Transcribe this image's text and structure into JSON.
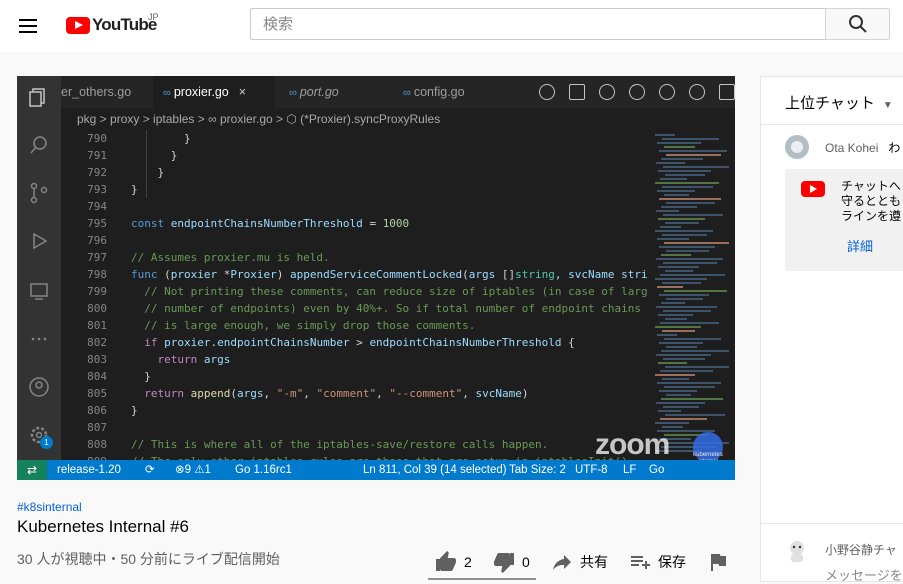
{
  "header": {
    "logo_text": "YouTube",
    "logo_region": "JP",
    "search_placeholder": "検索"
  },
  "player": {
    "tabs": [
      {
        "label": "er_others.go"
      },
      {
        "label": "proxier.go",
        "close": "×"
      },
      {
        "label": "port.go"
      },
      {
        "label": "config.go"
      }
    ],
    "tab_go_glyph": "∞",
    "breadcrumb": "pkg  >  proxy  >  iptables  >  ∞ proxier.go  >  ⬡ (*Proxier).syncProxyRules",
    "code_lines": [
      {
        "n": "790",
        "t": "        }"
      },
      {
        "n": "791",
        "t": "      }"
      },
      {
        "n": "792",
        "t": "    }"
      },
      {
        "n": "793",
        "t": "}"
      },
      {
        "n": "794",
        "t": ""
      },
      {
        "n": "795",
        "t": "const endpointChainsNumberThreshold = 1000"
      },
      {
        "n": "796",
        "t": ""
      },
      {
        "n": "797",
        "t": "// Assumes proxier.mu is held."
      },
      {
        "n": "798",
        "t": "func (proxier *Proxier) appendServiceCommentLocked(args []string, svcName stri"
      },
      {
        "n": "799",
        "t": "  // Not printing these comments, can reduce size of iptables (in case of larg"
      },
      {
        "n": "800",
        "t": "  // number of endpoints) even by 40%+. So if total number of endpoint chains"
      },
      {
        "n": "801",
        "t": "  // is large enough, we simply drop those comments."
      },
      {
        "n": "802",
        "t": "  if proxier.endpointChainsNumber > endpointChainsNumberThreshold {"
      },
      {
        "n": "803",
        "t": "    return args"
      },
      {
        "n": "804",
        "t": "  }"
      },
      {
        "n": "805",
        "t": "  return append(args, \"-m\", \"comment\", \"--comment\", svcName)"
      },
      {
        "n": "806",
        "t": "}"
      },
      {
        "n": "807",
        "t": ""
      },
      {
        "n": "808",
        "t": "// This is where all of the iptables-save/restore calls happen."
      },
      {
        "n": "809",
        "t": "// The only other iptables rules are those that are setup in iptablesInit()"
      }
    ],
    "status": {
      "remote": "⇄",
      "branch": "release-1.20",
      "sync": "⟳",
      "problems": "⊗9 ⚠1",
      "go_version": "Go 1.16rc1",
      "position": "Ln 811, Col 39 (14 selected)",
      "tab_size": "Tab Size: 2",
      "encoding": "UTF-8",
      "eol": "LF",
      "language": "Go"
    },
    "activity_badge": "1",
    "watermark": "zoom",
    "watermark_sub": "kubernetes internal"
  },
  "video": {
    "hashtag": "#k8sinternal",
    "title": "Kubernetes Internal #6",
    "view_info": "30 人が視聴中・50 分前にライブ配信開始",
    "likes": "2",
    "dislikes": "0",
    "share_label": "共有",
    "save_label": "保存"
  },
  "chat": {
    "header_title": "上位チャット",
    "message_author": "Ota Kohei",
    "message_text": "わ",
    "notice_text": "チャットへ\n守るととも\nラインを遵",
    "notice_link": "詳細",
    "input_author": "小野谷静チャ",
    "input_placeholder": "メッセージを"
  },
  "colors": {
    "brand_red": "#ff0000",
    "link_blue": "#065fd4",
    "status_blue": "#007acc"
  }
}
